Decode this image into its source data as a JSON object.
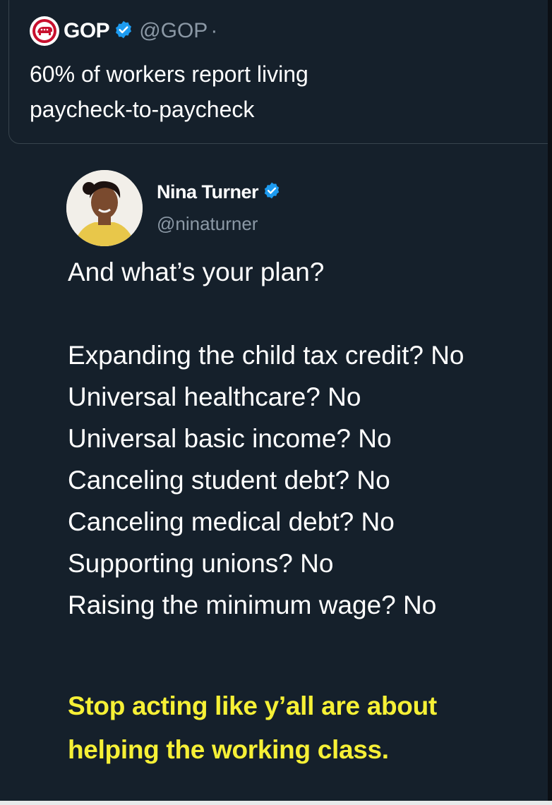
{
  "quoted_tweet": {
    "display_name": "GOP",
    "handle": "@GOP",
    "separator": "·",
    "text": "60% of workers report living\npaycheck-to-paycheck",
    "logo_icon": "gop-elephant-logo",
    "verified_icon": "verified-badge-icon"
  },
  "tweet": {
    "display_name": "Nina Turner",
    "handle": "@ninaturner",
    "verified_icon": "verified-badge-icon",
    "question": "And what’s your plan?",
    "list": [
      "Expanding the child tax credit? No",
      "Universal healthcare? No",
      "Universal basic income? No",
      "Canceling student debt? No",
      "Canceling medical debt? No",
      "Supporting unions? No",
      "Raising the minimum wage? No"
    ],
    "closing": "Stop acting like y’all are about\nhelping the working class."
  },
  "colors": {
    "background": "#15202b",
    "verified_blue": "#1d9bf0",
    "handle_gray": "#8b98a5",
    "highlight_yellow": "#f6f036",
    "gop_red": "#c8102e"
  }
}
